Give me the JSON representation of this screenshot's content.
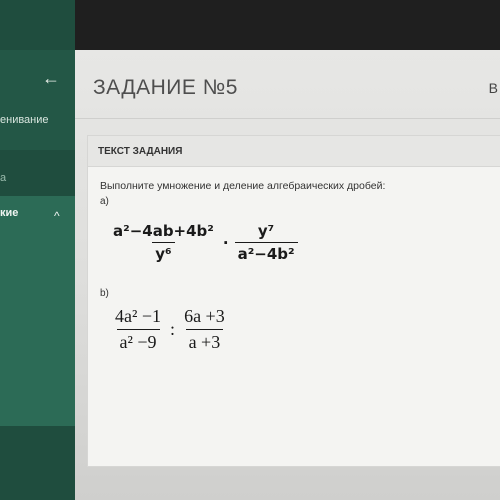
{
  "sidebar": {
    "items": [
      {
        "label": "енивание"
      },
      {
        "label": "а"
      },
      {
        "label": "кие"
      }
    ]
  },
  "header": {
    "title": "ЗАДАНИЕ №5",
    "extra": "В"
  },
  "task": {
    "section_title": "ТЕКСТ ЗАДАНИЯ",
    "instruction": "Выполните умножение и деление алгебраических дробей:",
    "part_a": {
      "label": "а)",
      "left": {
        "num": "a²−4ab+4b²",
        "den": "y⁶"
      },
      "operator": "·",
      "right": {
        "num": "y⁷",
        "den": "a²−4b²"
      }
    },
    "part_b": {
      "label": "b)",
      "left": {
        "num": "4a² −1",
        "den": "a² −9"
      },
      "operator": ":",
      "right": {
        "num": "6a +3",
        "den": "a +3"
      }
    }
  }
}
